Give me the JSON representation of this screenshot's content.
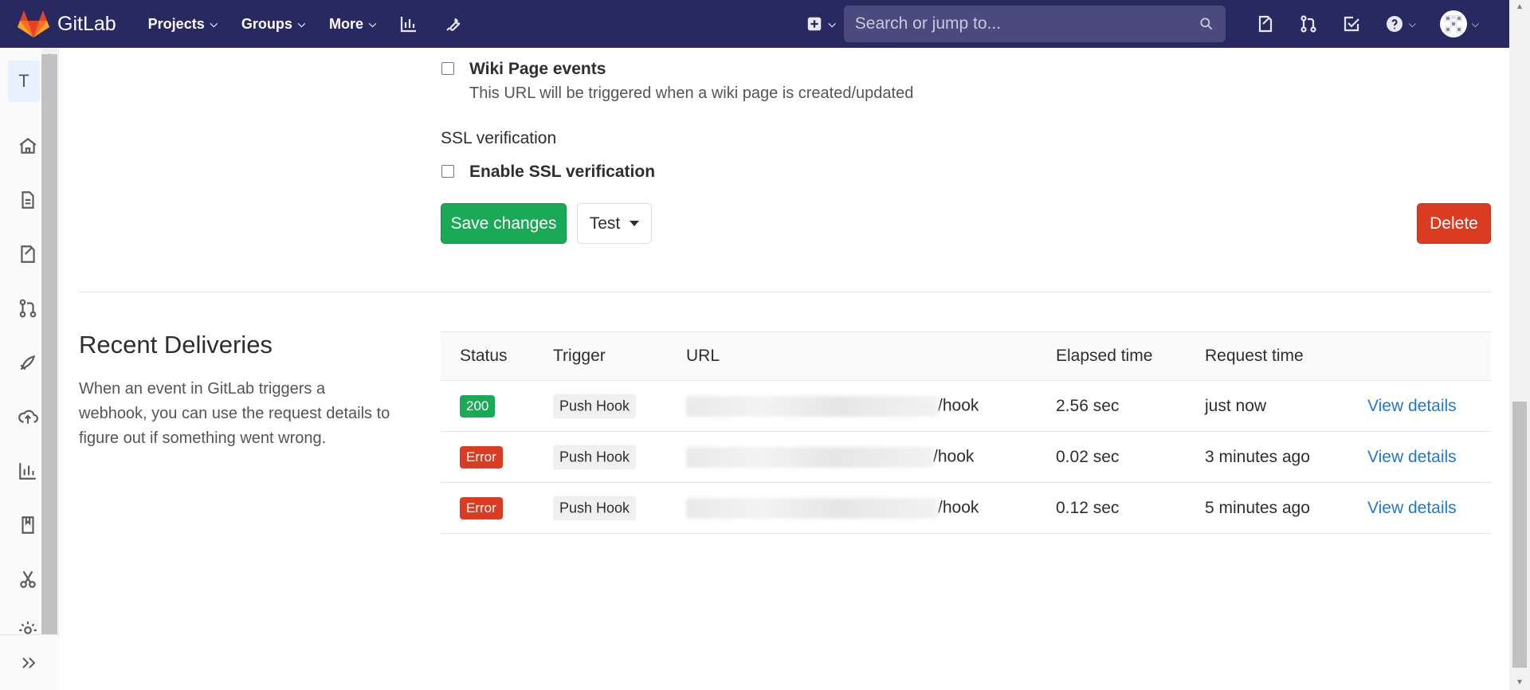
{
  "topnav": {
    "brand": "GitLab",
    "menu": [
      {
        "label": "Projects"
      },
      {
        "label": "Groups"
      },
      {
        "label": "More"
      }
    ],
    "search_placeholder": "Search or jump to..."
  },
  "sidebar": {
    "project_initial": "T"
  },
  "form": {
    "wiki_events_label": "Wiki Page events",
    "wiki_events_help": "This URL will be triggered when a wiki page is created/updated",
    "ssl_heading": "SSL verification",
    "ssl_label": "Enable SSL verification",
    "save_label": "Save changes",
    "test_label": "Test",
    "delete_label": "Delete"
  },
  "deliveries": {
    "title": "Recent Deliveries",
    "description_lines": [
      "When an event in GitLab triggers a",
      "webhook, you can use the request details to",
      "figure out if something went wrong."
    ],
    "columns": [
      "Status",
      "Trigger",
      "URL",
      "Elapsed time",
      "Request time"
    ],
    "rows": [
      {
        "status": "200",
        "trigger": "Push Hook",
        "url_suffix": "/hook",
        "elapsed": "2.56 sec",
        "request_time": "just now",
        "action": "View details"
      },
      {
        "status": "Error",
        "trigger": "Push Hook",
        "url_suffix": "/hook",
        "elapsed": "0.02 sec",
        "request_time": "3 minutes ago",
        "action": "View details"
      },
      {
        "status": "Error",
        "trigger": "Push Hook",
        "url_suffix": "/hook",
        "elapsed": "0.12 sec",
        "request_time": "5 minutes ago",
        "action": "View details"
      }
    ]
  },
  "colors": {
    "nav_bg": "#292961",
    "success": "#1aaa55",
    "danger": "#db3b21",
    "link": "#1f78d1"
  }
}
